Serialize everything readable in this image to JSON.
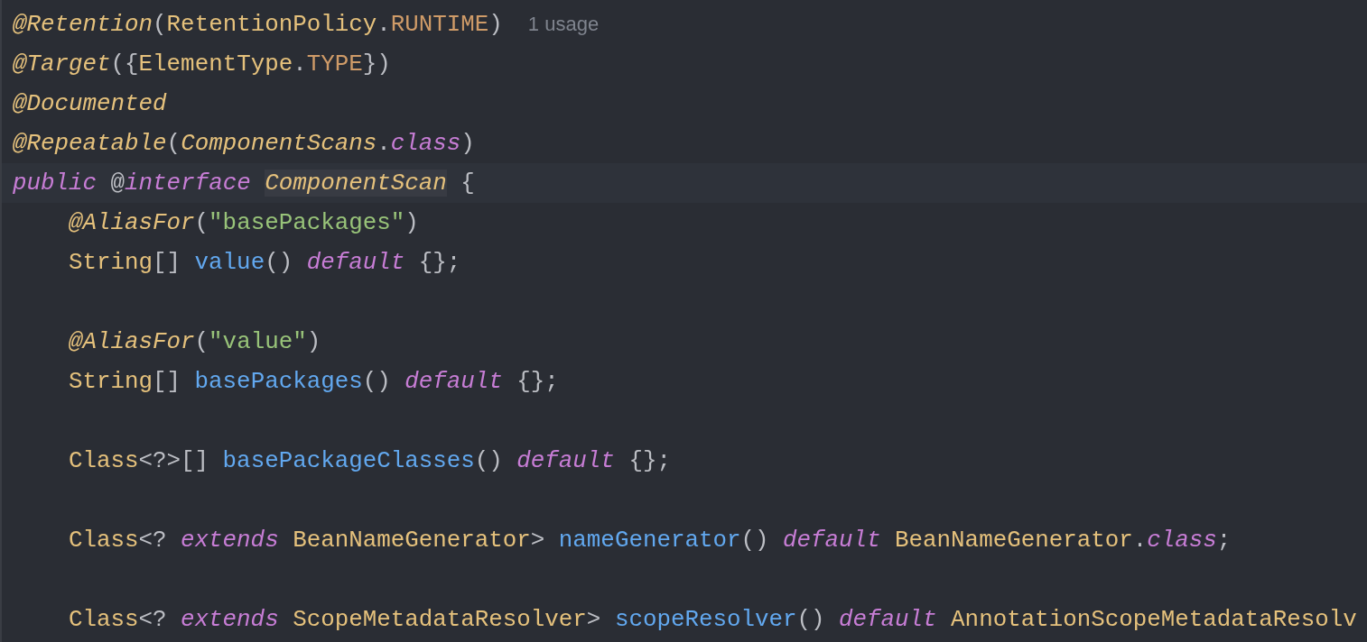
{
  "editor": {
    "lines": [
      {
        "kind": "code",
        "current": false,
        "tokens": [
          {
            "text": "@Retention",
            "kind": "annotation"
          },
          {
            "text": "(",
            "kind": "plain"
          },
          {
            "text": "RetentionPolicy",
            "kind": "type"
          },
          {
            "text": ".",
            "kind": "plain"
          },
          {
            "text": "RUNTIME",
            "kind": "constant"
          },
          {
            "text": ")",
            "kind": "plain"
          }
        ],
        "hint": "1 usage"
      },
      {
        "kind": "code",
        "current": false,
        "tokens": [
          {
            "text": "@Target",
            "kind": "annotation"
          },
          {
            "text": "({",
            "kind": "plain"
          },
          {
            "text": "ElementType",
            "kind": "type"
          },
          {
            "text": ".",
            "kind": "plain"
          },
          {
            "text": "TYPE",
            "kind": "constant"
          },
          {
            "text": "})",
            "kind": "plain"
          }
        ]
      },
      {
        "kind": "code",
        "current": false,
        "tokens": [
          {
            "text": "@Documented",
            "kind": "annotation"
          }
        ]
      },
      {
        "kind": "code",
        "current": false,
        "tokens": [
          {
            "text": "@Repeatable",
            "kind": "annotation"
          },
          {
            "text": "(",
            "kind": "plain"
          },
          {
            "text": "ComponentScans",
            "kind": "typeref"
          },
          {
            "text": ".",
            "kind": "plain"
          },
          {
            "text": "class",
            "kind": "keyword"
          },
          {
            "text": ")",
            "kind": "plain"
          }
        ]
      },
      {
        "kind": "code",
        "current": true,
        "tokens": [
          {
            "text": "public",
            "kind": "keyword"
          },
          {
            "text": " @",
            "kind": "plain"
          },
          {
            "text": "interface ",
            "kind": "keyword"
          },
          {
            "text": "ComponentScan",
            "kind": "typeref",
            "highlighted": true
          },
          {
            "text": " {",
            "kind": "plain"
          }
        ],
        "children": [
          {
            "kind": "code",
            "current": false,
            "tokens": [
              {
                "text": "@AliasFor",
                "kind": "annotation"
              },
              {
                "text": "(",
                "kind": "plain"
              },
              {
                "text": "\"basePackages\"",
                "kind": "string"
              },
              {
                "text": ")",
                "kind": "plain"
              }
            ]
          },
          {
            "kind": "code",
            "current": false,
            "tokens": [
              {
                "text": "String",
                "kind": "type"
              },
              {
                "text": "[] ",
                "kind": "plain"
              },
              {
                "text": "value",
                "kind": "method"
              },
              {
                "text": "() ",
                "kind": "plain"
              },
              {
                "text": "default",
                "kind": "keyword"
              },
              {
                "text": " {};",
                "kind": "plain"
              }
            ]
          },
          {
            "kind": "blank"
          },
          {
            "kind": "code",
            "current": false,
            "tokens": [
              {
                "text": "@AliasFor",
                "kind": "annotation"
              },
              {
                "text": "(",
                "kind": "plain"
              },
              {
                "text": "\"value\"",
                "kind": "string"
              },
              {
                "text": ")",
                "kind": "plain"
              }
            ]
          },
          {
            "kind": "code",
            "current": false,
            "tokens": [
              {
                "text": "String",
                "kind": "type"
              },
              {
                "text": "[] ",
                "kind": "plain"
              },
              {
                "text": "basePackages",
                "kind": "method"
              },
              {
                "text": "() ",
                "kind": "plain"
              },
              {
                "text": "default",
                "kind": "keyword"
              },
              {
                "text": " {};",
                "kind": "plain"
              }
            ]
          },
          {
            "kind": "blank"
          },
          {
            "kind": "code",
            "current": false,
            "tokens": [
              {
                "text": "Class",
                "kind": "type"
              },
              {
                "text": "<?>[] ",
                "kind": "plain"
              },
              {
                "text": "basePackageClasses",
                "kind": "method"
              },
              {
                "text": "() ",
                "kind": "plain"
              },
              {
                "text": "default",
                "kind": "keyword"
              },
              {
                "text": " {};",
                "kind": "plain"
              }
            ]
          },
          {
            "kind": "blank"
          },
          {
            "kind": "code",
            "current": false,
            "tokens": [
              {
                "text": "Class",
                "kind": "type"
              },
              {
                "text": "<? ",
                "kind": "plain"
              },
              {
                "text": "extends ",
                "kind": "keyword"
              },
              {
                "text": "BeanNameGenerator",
                "kind": "type"
              },
              {
                "text": "> ",
                "kind": "plain"
              },
              {
                "text": "nameGenerator",
                "kind": "method"
              },
              {
                "text": "() ",
                "kind": "plain"
              },
              {
                "text": "default ",
                "kind": "keyword"
              },
              {
                "text": "BeanNameGenerator",
                "kind": "type"
              },
              {
                "text": ".",
                "kind": "plain"
              },
              {
                "text": "class",
                "kind": "keyword"
              },
              {
                "text": ";",
                "kind": "plain"
              }
            ]
          },
          {
            "kind": "blank"
          },
          {
            "kind": "code",
            "current": false,
            "tokens": [
              {
                "text": "Class",
                "kind": "type"
              },
              {
                "text": "<? ",
                "kind": "plain"
              },
              {
                "text": "extends ",
                "kind": "keyword"
              },
              {
                "text": "ScopeMetadataResolver",
                "kind": "type"
              },
              {
                "text": "> ",
                "kind": "plain"
              },
              {
                "text": "scopeResolver",
                "kind": "method"
              },
              {
                "text": "() ",
                "kind": "plain"
              },
              {
                "text": "default ",
                "kind": "keyword"
              },
              {
                "text": "AnnotationScopeMetadataResolv",
                "kind": "type"
              }
            ]
          }
        ]
      }
    ]
  }
}
